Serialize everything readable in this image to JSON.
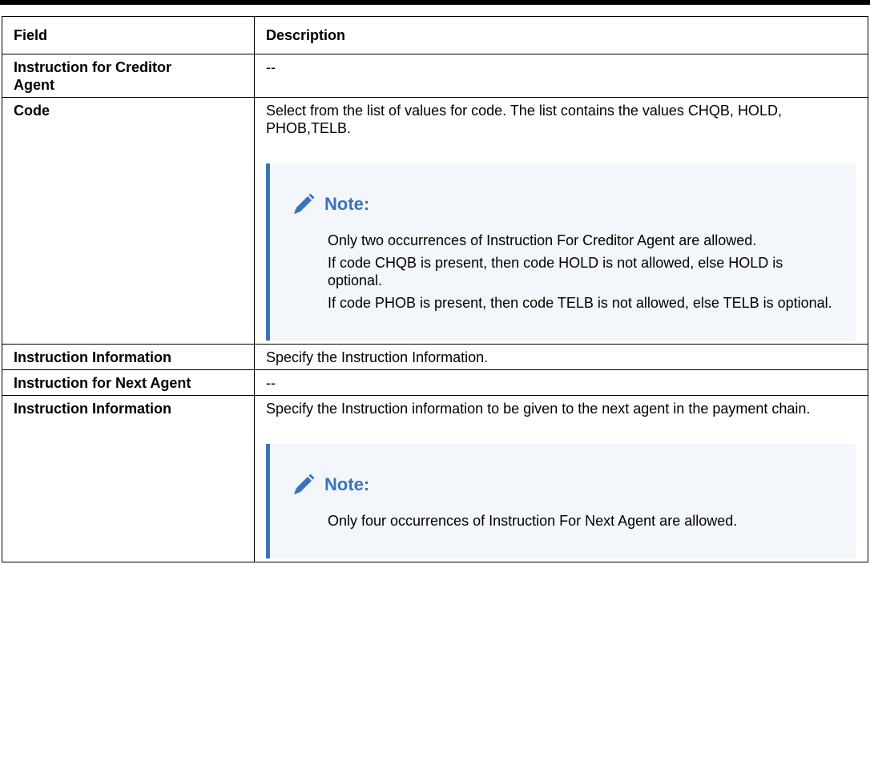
{
  "table": {
    "headers": [
      "Field",
      "Description"
    ],
    "rows": [
      {
        "field": "Instruction for Creditor Agent",
        "description": "--"
      },
      {
        "field": "Code",
        "description": "Select from the list of values for code. The list contains the values CHQB, HOLD, PHOB,TELB."
      },
      {
        "field": "Instruction Information",
        "description": "Specify the Instruction Information."
      },
      {
        "field": "Instruction for Next Agent",
        "description": "--"
      },
      {
        "field": "Instruction Information",
        "description": "Specify the Instruction information to be given to the next agent in the payment chain."
      }
    ]
  },
  "notes": {
    "note1": {
      "title": "Note:",
      "icon": "pencil-icon",
      "lines": [
        "Only two occurrences of Instruction For Creditor Agent are allowed.",
        "If code CHQB is present, then code HOLD is not allowed, else HOLD is optional.",
        "If code PHOB is present, then code TELB is not allowed, else TELB is optional."
      ]
    },
    "note2": {
      "title": "Note:",
      "icon": "pencil-icon",
      "lines": [
        "Only four occurrences of Instruction For Next Agent are allowed."
      ]
    }
  },
  "colors": {
    "accent": "#3a73bc",
    "note_bg": "#f3f7fc"
  }
}
